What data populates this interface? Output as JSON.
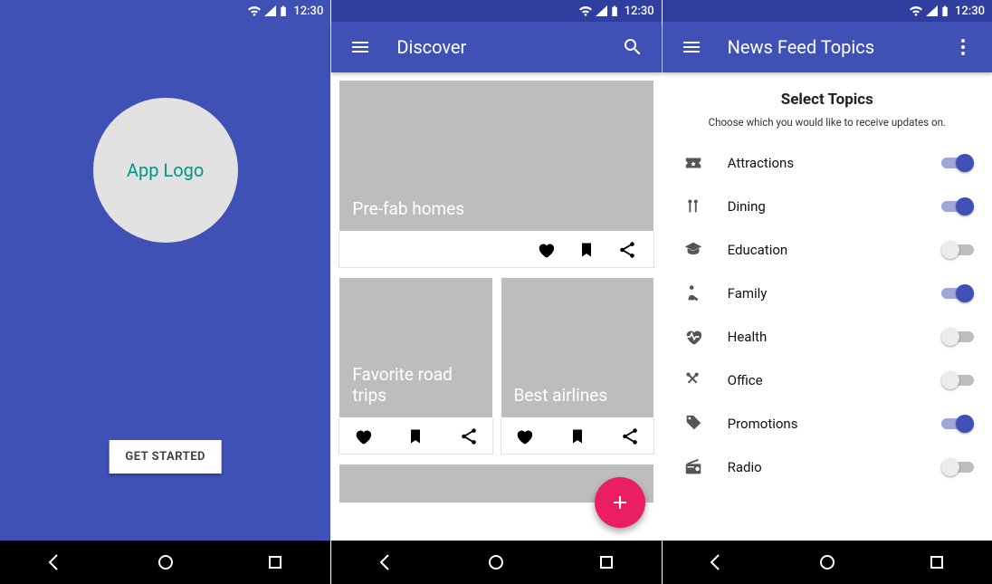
{
  "status": {
    "time": "12:30"
  },
  "screen1": {
    "logo_text": "App Logo",
    "cta": "GET STARTED"
  },
  "screen2": {
    "title": "Discover",
    "cards": {
      "big": "Pre-fab homes",
      "small": [
        "Favorite road trips",
        "Best airlines"
      ]
    }
  },
  "screen3": {
    "title": "News Feed Topics",
    "heading": "Select Topics",
    "subtitle": "Choose which you would like to receive updates on.",
    "topics": [
      {
        "label": "Attractions",
        "icon": "ticket",
        "on": true
      },
      {
        "label": "Dining",
        "icon": "dining",
        "on": true
      },
      {
        "label": "Education",
        "icon": "education",
        "on": false
      },
      {
        "label": "Family",
        "icon": "family",
        "on": true
      },
      {
        "label": "Health",
        "icon": "health",
        "on": false
      },
      {
        "label": "Office",
        "icon": "office",
        "on": false
      },
      {
        "label": "Promotions",
        "icon": "promotions",
        "on": true
      },
      {
        "label": "Radio",
        "icon": "radio",
        "on": false
      }
    ]
  },
  "colors": {
    "primary": "#3F51B5",
    "primaryDark": "#303F9F",
    "accent": "#E91E63",
    "teal": "#009688"
  }
}
